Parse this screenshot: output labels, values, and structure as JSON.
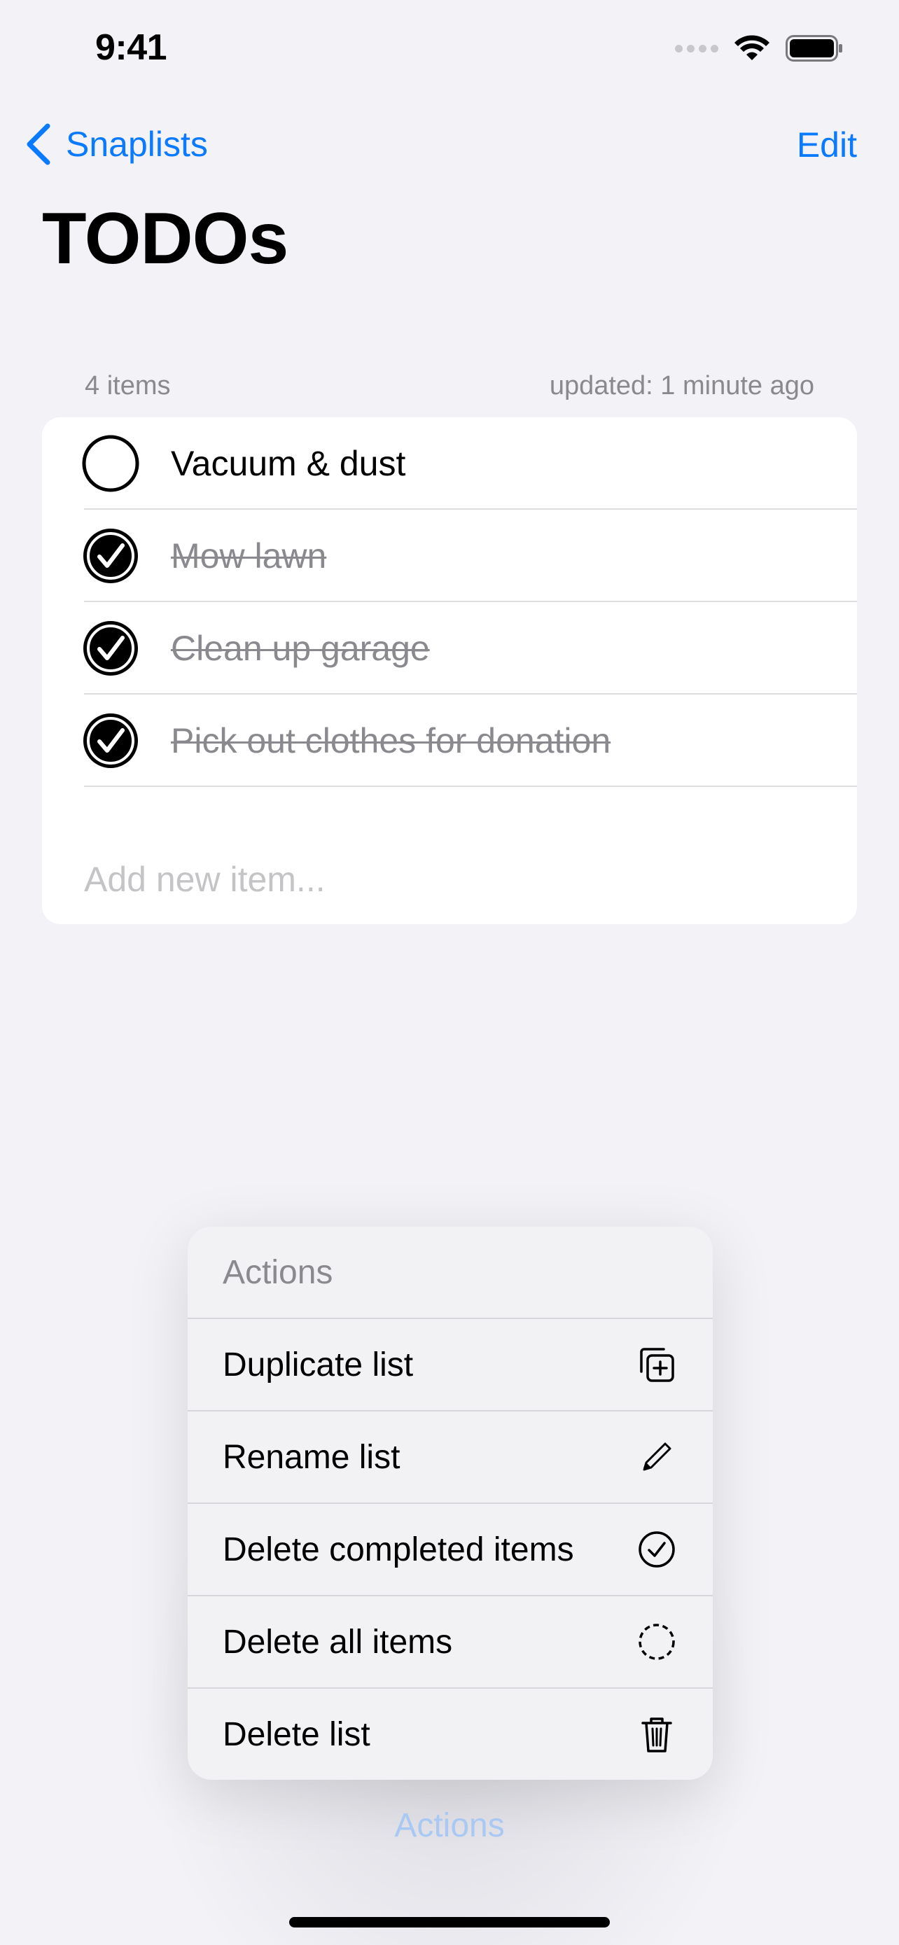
{
  "status_bar": {
    "time": "9:41"
  },
  "nav": {
    "back_label": "Snaplists",
    "edit_label": "Edit",
    "title": "TODOs"
  },
  "list": {
    "count_label": "4 items",
    "updated_label": "updated: 1 minute ago",
    "items": [
      {
        "label": "Vacuum & dust",
        "completed": false
      },
      {
        "label": "Mow lawn",
        "completed": true
      },
      {
        "label": "Clean up garage",
        "completed": true
      },
      {
        "label": "Pick out clothes for donation",
        "completed": true
      }
    ],
    "add_placeholder": "Add new item..."
  },
  "menu": {
    "header": "Actions",
    "items": [
      {
        "label": "Duplicate list",
        "icon": "duplicate-plus-icon"
      },
      {
        "label": "Rename list",
        "icon": "pencil-icon"
      },
      {
        "label": "Delete completed items",
        "icon": "checkmark-circle-icon"
      },
      {
        "label": "Delete all items",
        "icon": "dashed-circle-icon"
      },
      {
        "label": "Delete list",
        "icon": "trash-icon"
      }
    ]
  },
  "actions_button_label": "Actions",
  "colors": {
    "accent": "#0a7aff",
    "background": "#f2f2f7",
    "secondary_text": "#8a8a8e"
  }
}
